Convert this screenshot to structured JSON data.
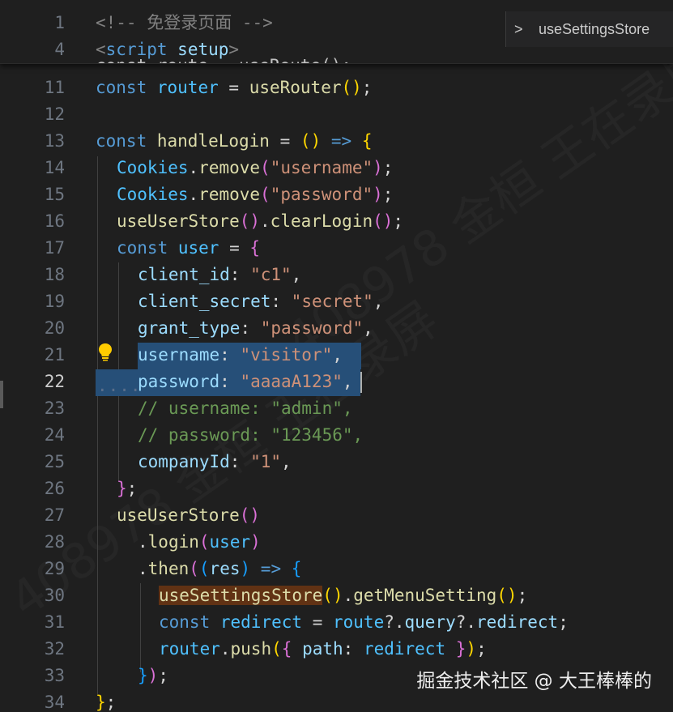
{
  "sticky": {
    "line1_num": "1",
    "line1_text": "<!-- 免登录页面 -->",
    "line4_num": "4",
    "line4_tag_open": "<",
    "line4_tag_name": "script",
    "line4_attr": "setup",
    "line4_tag_close": ">",
    "peek_text": "const route = useRoute();"
  },
  "breadcrumb": {
    "chevron": ">",
    "label": "useSettingsStore"
  },
  "lines": {
    "n11": "11",
    "n12": "12",
    "n13": "13",
    "n14": "14",
    "n15": "15",
    "n16": "16",
    "n17": "17",
    "n18": "18",
    "n19": "19",
    "n20": "20",
    "n21": "21",
    "n22": "22",
    "n23": "23",
    "n24": "24",
    "n25": "25",
    "n26": "26",
    "n27": "27",
    "n28": "28",
    "n29": "29",
    "n30": "30",
    "n31": "31",
    "n32": "32",
    "n33": "33",
    "n34": "34"
  },
  "code": {
    "const": "const",
    "router": "router",
    "useRouter": "useRouter",
    "handleLogin": "handleLogin",
    "arrow": "=>",
    "Cookies": "Cookies",
    "remove": "remove",
    "username_str": "\"username\"",
    "password_str": "\"password\"",
    "useUserStore": "useUserStore",
    "clearLogin": "clearLogin",
    "user": "user",
    "client_id": "client_id",
    "c1": "\"c1\"",
    "client_secret": "client_secret",
    "secret": "\"secret\"",
    "grant_type": "grant_type",
    "grant_val": "\"password\"",
    "username_key": "username",
    "visitor": "\"visitor\"",
    "password_key": "password",
    "aaaa": "\"aaaaA123\"",
    "cmt_username": "// username: \"admin\",",
    "cmt_password": "// password: \"123456\",",
    "companyId": "companyId",
    "one": "\"1\"",
    "login": "login",
    "then": "then",
    "res": "res",
    "useSettingsStore": "useSettingsStore",
    "getMenuSetting": "getMenuSetting",
    "redirect": "redirect",
    "route": "route",
    "query": "query",
    "push": "push",
    "path": "path"
  },
  "watermark": {
    "text": "掘金技术社区 @ 大王棒棒的"
  },
  "colors": {
    "background": "#1f1f1f",
    "selection": "#264f78",
    "word_highlight": "#613214",
    "keyword": "#569cd6",
    "string": "#ce9178",
    "function": "#dcdcaa",
    "property": "#9cdcfe",
    "comment": "#6a9955"
  }
}
